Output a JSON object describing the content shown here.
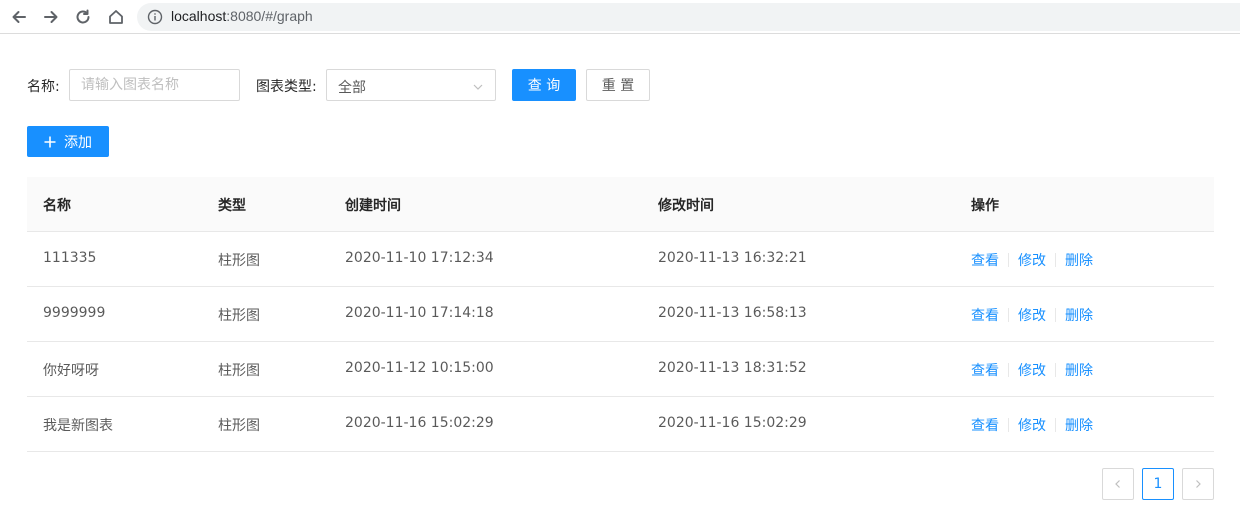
{
  "browser": {
    "url_host": "localhost",
    "url_rest": ":8080/#/graph"
  },
  "search": {
    "name_label": "名称:",
    "name_placeholder": "请输入图表名称",
    "type_label": "图表类型:",
    "type_value": "全部",
    "query_label": "查 询",
    "reset_label": "重 置"
  },
  "toolbar": {
    "add_label": "添加"
  },
  "table": {
    "columns": [
      "名称",
      "类型",
      "创建时间",
      "修改时间",
      "操作"
    ],
    "rows": [
      {
        "name": "111335",
        "type": "柱形图",
        "created": "2020-11-10 17:12:34",
        "modified": "2020-11-13 16:32:21"
      },
      {
        "name": "9999999",
        "type": "柱形图",
        "created": "2020-11-10 17:14:18",
        "modified": "2020-11-13 16:58:13"
      },
      {
        "name": "你好呀呀",
        "type": "柱形图",
        "created": "2020-11-12 10:15:00",
        "modified": "2020-11-13 18:31:52"
      },
      {
        "name": "我是新图表",
        "type": "柱形图",
        "created": "2020-11-16 15:02:29",
        "modified": "2020-11-16 15:02:29"
      }
    ],
    "actions": {
      "view": "查看",
      "edit": "修改",
      "delete": "删除"
    }
  },
  "pagination": {
    "current_page": "1"
  },
  "colors": {
    "primary": "#1890ff",
    "border": "#d9d9d9",
    "header_bg": "#fafafa"
  }
}
